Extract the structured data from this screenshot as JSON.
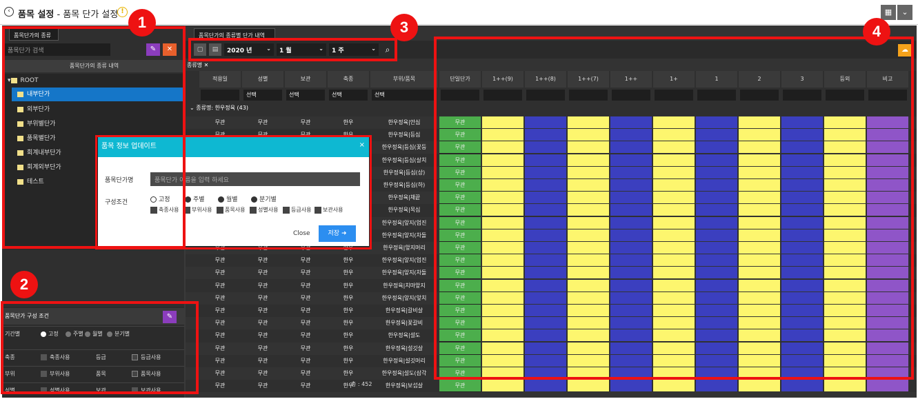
{
  "window": {
    "title": "품목 설정",
    "subtitle": " - 품목 단가 설정"
  },
  "left": {
    "tab": "품목단가의 종류",
    "search_placeholder": "품목단가 검색",
    "section_title": "품목단가의 종류 내역",
    "tree": [
      "ROOT",
      "내부단가",
      "외부단가",
      "부위별단가",
      "품목별단가",
      "회계내부단가",
      "회계외부단가",
      "테스트"
    ]
  },
  "cond": {
    "title": "품목단가 구성 조건",
    "period_label": "기간별",
    "period_opts": [
      "고정",
      "주별",
      "월별",
      "분기별"
    ],
    "rows": [
      {
        "k1": "축종",
        "c1": "축종사용",
        "k2": "등급",
        "c2": "등급사용"
      },
      {
        "k1": "부위",
        "c1": "부위사용",
        "k2": "품목",
        "c2": "품목사용"
      },
      {
        "k1": "성별",
        "c1": "성별사용",
        "k2": "보관",
        "c2": "보관사용"
      }
    ]
  },
  "main": {
    "tab": "품목단가의 종류별 단가 내역",
    "year": "2020 년",
    "month": "1 월",
    "week": "1 주",
    "tag": "종류명",
    "columns": [
      "적용일",
      "성별",
      "보관",
      "축종",
      "부위/품목",
      "단일단가",
      "1++(9)",
      "1++(8)",
      "1++(7)",
      "1++",
      "1+",
      "1",
      "2",
      "3",
      "등외",
      "비고"
    ],
    "filter_opt": "선택",
    "group": "종류명: 한우정육 (43)",
    "val": "무관",
    "species": "한우",
    "items": [
      "한우정육|안심",
      "한우정육|등심",
      "한우정육|등심(꽃등",
      "한우정육|등심(살치",
      "한우정육|등심(상)",
      "한우정육|등심(하)",
      "한우정육|채끝",
      "한우정육|목심",
      "한우정육|앞지(업진",
      "한우정육|앞지(차돌",
      "한우정육|앞지머리",
      "한우정육|앞지(업진",
      "한우정육|앞지(차돌",
      "한우정육|치마앞지",
      "한우정육|앞지(앞치",
      "한우정육|갈비살",
      "한우정육|꽃갈비",
      "한우정육|설도",
      "한우정육|설깃살",
      "한우정육|설깃머리",
      "한우정육|설도(삼각",
      "한우정육|보섭살"
    ],
    "total": "총 : 452"
  },
  "modal": {
    "title": "품목 정보 업데이트",
    "name_label": "품목단가명",
    "name_placeholder": "품목단가 이름을 입력 하세요",
    "cond_label": "구성조건",
    "period_opts": [
      "고정",
      "주별",
      "월별",
      "분기별"
    ],
    "use_opts": [
      "축종사용",
      "부위사용",
      "품목사용",
      "성별사용",
      "등급사용",
      "보관사용"
    ],
    "close": "Close",
    "save": "저장"
  },
  "badges": [
    "1",
    "2",
    "3",
    "4"
  ],
  "colors": {
    "green": "#4cae4c",
    "yellow": "#fdf66e",
    "blue": "#3b3fbf",
    "purple": "#8f55c8",
    "red": "#ee1212"
  }
}
